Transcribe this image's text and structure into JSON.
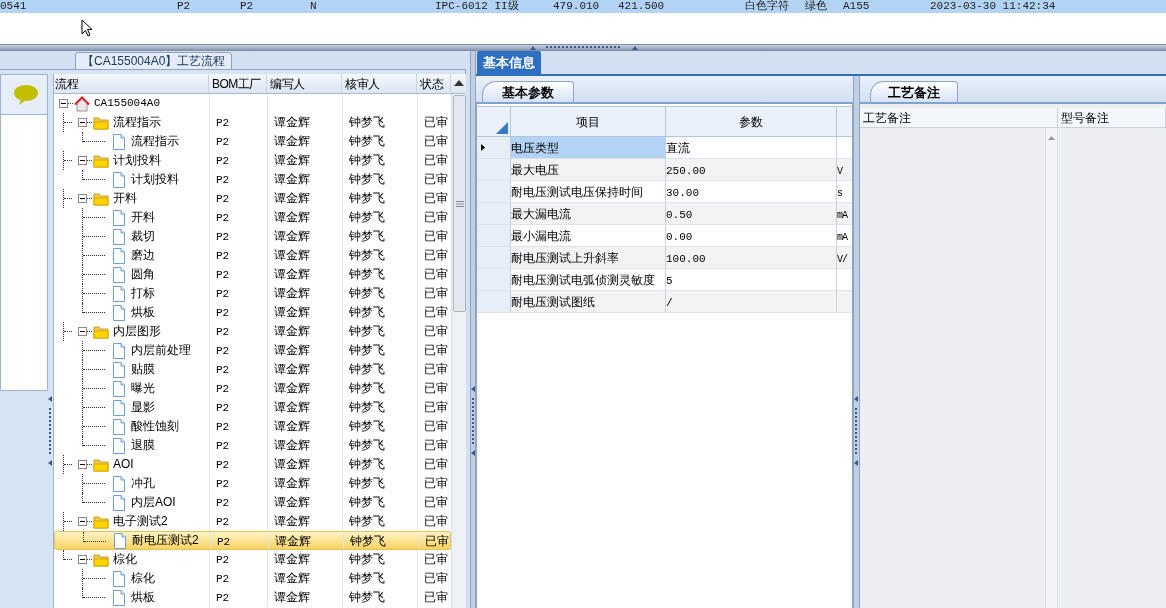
{
  "top_row": {
    "cells": [
      "0541",
      "P2",
      "P2",
      "N",
      "IPC-6012 II级",
      "479.010",
      "421.500",
      "白色字符",
      "绿色",
      "A155",
      "2023-03-30 11:42:34"
    ]
  },
  "flow_panel": {
    "title": "【CA155004A0】工艺流程",
    "columns": [
      "流程",
      "BOM工厂",
      "编写人",
      "核审人",
      "状态"
    ],
    "tree": [
      {
        "kind": "root",
        "label": "CA155004A0",
        "expanded": true,
        "children": [
          {
            "kind": "group",
            "label": "流程指示",
            "bom": "P2",
            "author": "谭金辉",
            "reviewer": "钟梦飞",
            "status": "已审",
            "expanded": true,
            "children": [
              {
                "kind": "leaf",
                "label": "流程指示",
                "bom": "P2",
                "author": "谭金辉",
                "reviewer": "钟梦飞",
                "status": "已审",
                "selected": false
              }
            ]
          },
          {
            "kind": "group",
            "label": "计划投料",
            "bom": "P2",
            "author": "谭金辉",
            "reviewer": "钟梦飞",
            "status": "已审",
            "expanded": true,
            "children": [
              {
                "kind": "leaf",
                "label": "计划投料",
                "bom": "P2",
                "author": "谭金辉",
                "reviewer": "钟梦飞",
                "status": "已审",
                "selected": false
              }
            ]
          },
          {
            "kind": "group",
            "label": "开料",
            "bom": "P2",
            "author": "谭金辉",
            "reviewer": "钟梦飞",
            "status": "已审",
            "expanded": true,
            "children": [
              {
                "kind": "leaf",
                "label": "开料",
                "bom": "P2",
                "author": "谭金辉",
                "reviewer": "钟梦飞",
                "status": "已审",
                "selected": false
              },
              {
                "kind": "leaf",
                "label": "裁切",
                "bom": "P2",
                "author": "谭金辉",
                "reviewer": "钟梦飞",
                "status": "已审",
                "selected": false
              },
              {
                "kind": "leaf",
                "label": "磨边",
                "bom": "P2",
                "author": "谭金辉",
                "reviewer": "钟梦飞",
                "status": "已审",
                "selected": false
              },
              {
                "kind": "leaf",
                "label": "圆角",
                "bom": "P2",
                "author": "谭金辉",
                "reviewer": "钟梦飞",
                "status": "已审",
                "selected": false
              },
              {
                "kind": "leaf",
                "label": "打标",
                "bom": "P2",
                "author": "谭金辉",
                "reviewer": "钟梦飞",
                "status": "已审",
                "selected": false
              },
              {
                "kind": "leaf",
                "label": "烘板",
                "bom": "P2",
                "author": "谭金辉",
                "reviewer": "钟梦飞",
                "status": "已审",
                "selected": false
              }
            ]
          },
          {
            "kind": "group",
            "label": "内层图形",
            "bom": "P2",
            "author": "谭金辉",
            "reviewer": "钟梦飞",
            "status": "已审",
            "expanded": true,
            "children": [
              {
                "kind": "leaf",
                "label": "内层前处理",
                "bom": "P2",
                "author": "谭金辉",
                "reviewer": "钟梦飞",
                "status": "已审",
                "selected": false
              },
              {
                "kind": "leaf",
                "label": "贴膜",
                "bom": "P2",
                "author": "谭金辉",
                "reviewer": "钟梦飞",
                "status": "已审",
                "selected": false
              },
              {
                "kind": "leaf",
                "label": "曝光",
                "bom": "P2",
                "author": "谭金辉",
                "reviewer": "钟梦飞",
                "status": "已审",
                "selected": false
              },
              {
                "kind": "leaf",
                "label": "显影",
                "bom": "P2",
                "author": "谭金辉",
                "reviewer": "钟梦飞",
                "status": "已审",
                "selected": false
              },
              {
                "kind": "leaf",
                "label": "酸性蚀刻",
                "bom": "P2",
                "author": "谭金辉",
                "reviewer": "钟梦飞",
                "status": "已审",
                "selected": false
              },
              {
                "kind": "leaf",
                "label": "退膜",
                "bom": "P2",
                "author": "谭金辉",
                "reviewer": "钟梦飞",
                "status": "已审",
                "selected": false
              }
            ]
          },
          {
            "kind": "group",
            "label": "AOI",
            "bom": "P2",
            "author": "谭金辉",
            "reviewer": "钟梦飞",
            "status": "已审",
            "expanded": true,
            "children": [
              {
                "kind": "leaf",
                "label": "冲孔",
                "bom": "P2",
                "author": "谭金辉",
                "reviewer": "钟梦飞",
                "status": "已审",
                "selected": false
              },
              {
                "kind": "leaf",
                "label": "内层AOI",
                "bom": "P2",
                "author": "谭金辉",
                "reviewer": "钟梦飞",
                "status": "已审",
                "selected": false
              }
            ]
          },
          {
            "kind": "group",
            "label": "电子测试2",
            "bom": "P2",
            "author": "谭金辉",
            "reviewer": "钟梦飞",
            "status": "已审",
            "expanded": true,
            "children": [
              {
                "kind": "leaf",
                "label": "耐电压测试2",
                "bom": "P2",
                "author": "谭金辉",
                "reviewer": "钟梦飞",
                "status": "已审",
                "selected": true
              }
            ]
          },
          {
            "kind": "group",
            "label": "棕化",
            "bom": "P2",
            "author": "谭金辉",
            "reviewer": "钟梦飞",
            "status": "已审",
            "expanded": true,
            "children": [
              {
                "kind": "leaf",
                "label": "棕化",
                "bom": "P2",
                "author": "谭金辉",
                "reviewer": "钟梦飞",
                "status": "已审",
                "selected": false
              },
              {
                "kind": "leaf",
                "label": "烘板",
                "bom": "P2",
                "author": "谭金辉",
                "reviewer": "钟梦飞",
                "status": "已审",
                "selected": false
              }
            ]
          }
        ]
      }
    ]
  },
  "info_panel": {
    "tab": "基本信息",
    "subtab": "基本参数",
    "columns": [
      "项目",
      "参数"
    ],
    "rows": [
      {
        "item": "电压类型",
        "value": "直流",
        "unit": "",
        "selected": true
      },
      {
        "item": "最大电压",
        "value": "250.00",
        "unit": "V",
        "selected": false
      },
      {
        "item": "耐电压测试电压保持时间",
        "value": "30.00",
        "unit": "s",
        "selected": false
      },
      {
        "item": "最大漏电流",
        "value": "0.50",
        "unit": "mA",
        "selected": false
      },
      {
        "item": "最小漏电流",
        "value": "0.00",
        "unit": "mA",
        "selected": false
      },
      {
        "item": "耐电压测试上升斜率",
        "value": "100.00",
        "unit": "V/",
        "selected": false
      },
      {
        "item": "耐电压测试电弧侦测灵敏度",
        "value": "5",
        "unit": "",
        "selected": false
      },
      {
        "item": "耐电压测试图纸",
        "value": "/",
        "unit": "",
        "selected": false
      }
    ]
  },
  "notes_panel": {
    "tab": "工艺备注",
    "columns": [
      "工艺备注",
      "型号备注"
    ]
  }
}
